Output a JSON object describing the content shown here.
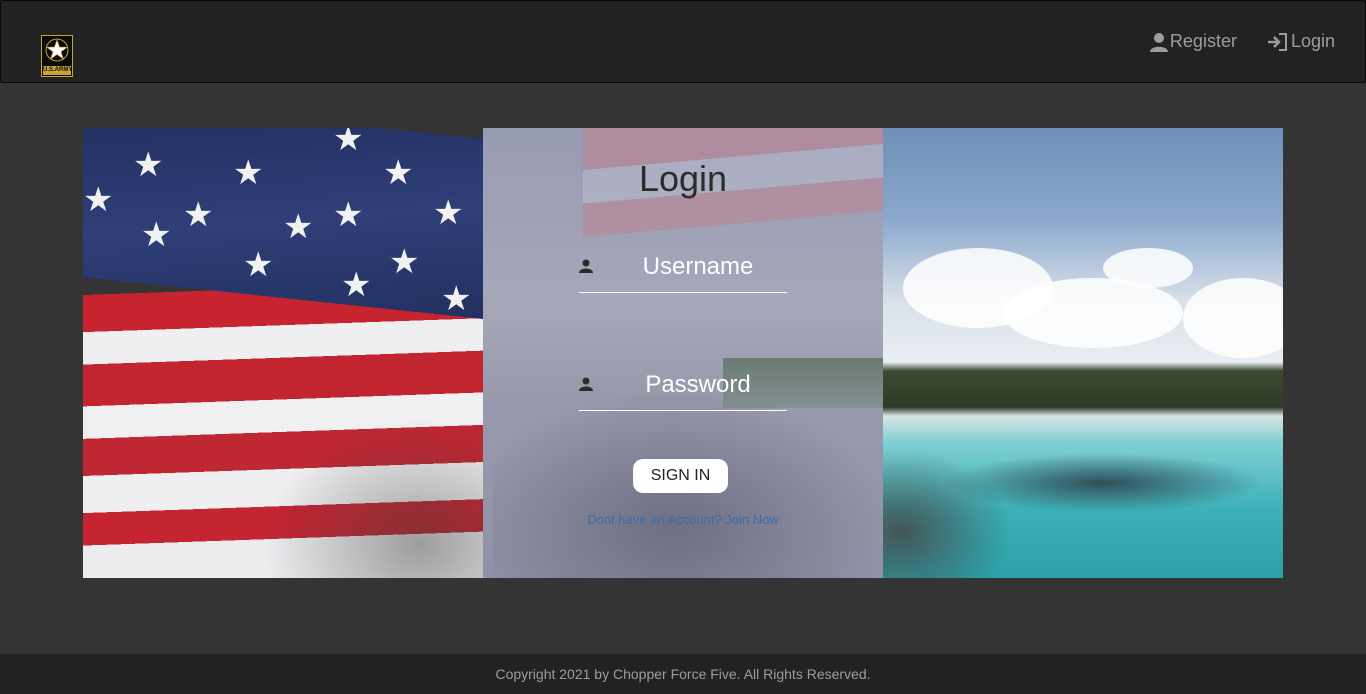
{
  "brand": {
    "logo_text": "U.S.ARMY"
  },
  "nav": {
    "register_label": "Register",
    "login_label": "Login"
  },
  "login": {
    "title": "Login",
    "username_placeholder": "Username",
    "password_placeholder": "Password",
    "signin_label": "SIGN IN",
    "join_text": "Dont have an Account? Join Now"
  },
  "footer": {
    "copyright": "Copyright 2021 by Chopper Force Five. All Rights Reserved."
  },
  "colors": {
    "navbar": "#222222",
    "page_background": "#343434",
    "link": "#3a6db0",
    "nav_text": "#9d9d9d"
  },
  "icons": {
    "brand": "army-star-logo",
    "register": "user-icon",
    "login": "sign-in-icon",
    "username": "user-icon",
    "password": "user-icon"
  }
}
